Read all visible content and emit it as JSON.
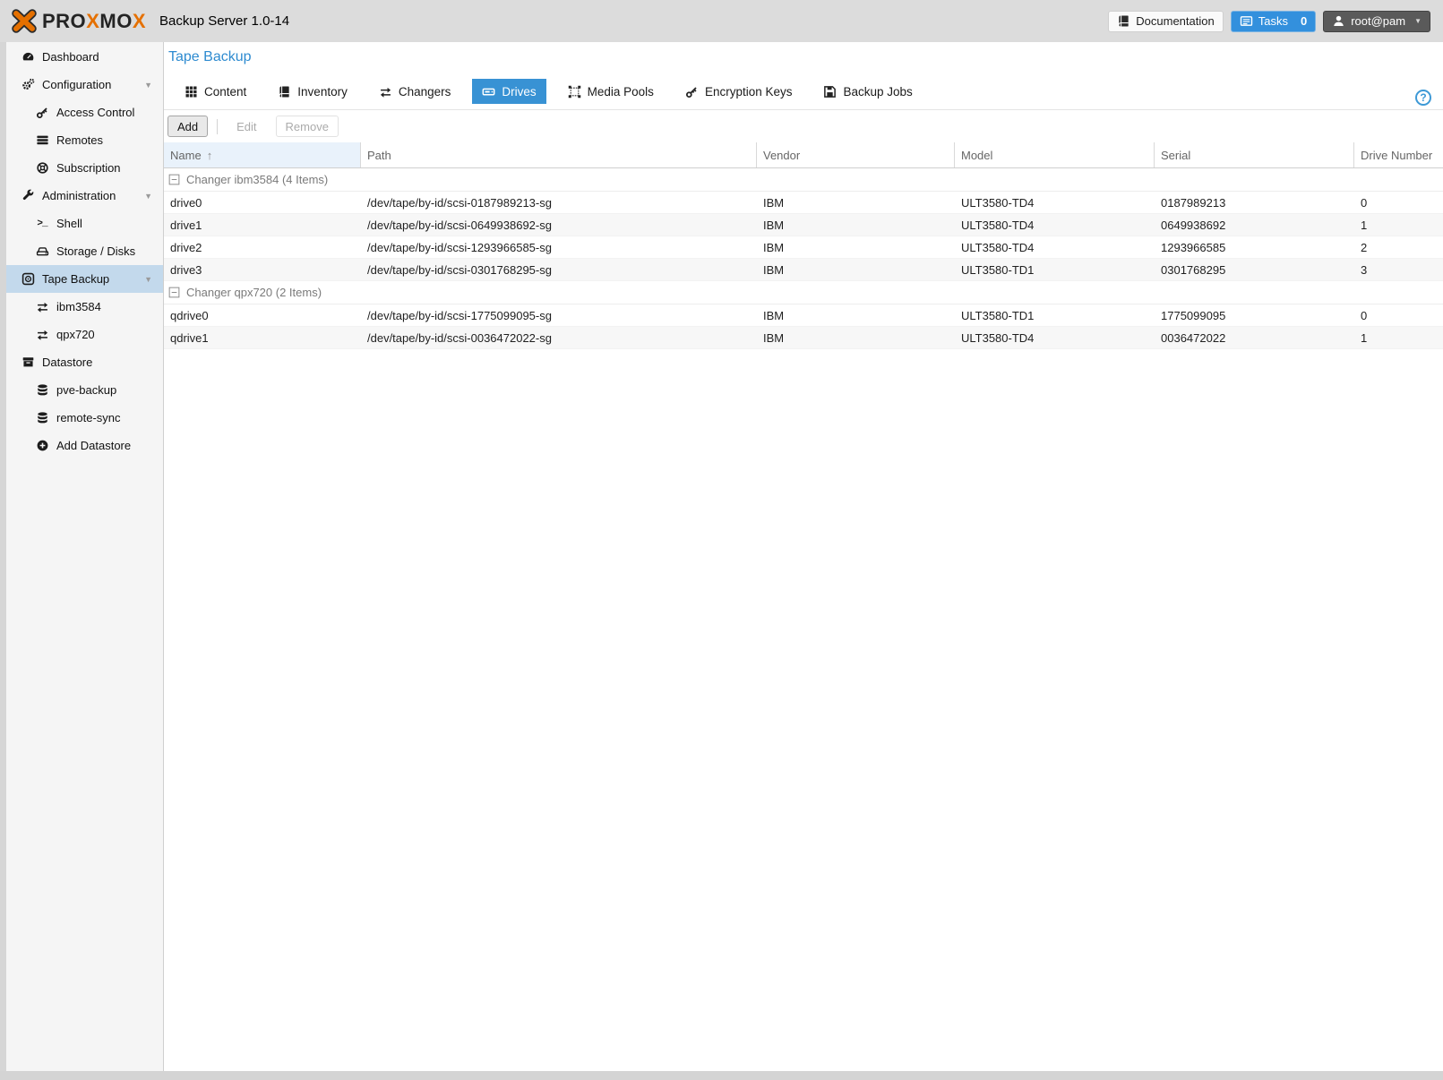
{
  "header": {
    "brand_pro": "PRO",
    "brand_x1": "X",
    "brand_mo": "MO",
    "brand_x2": "X",
    "app_title": "Backup Server 1.0-14",
    "documentation_label": "Documentation",
    "tasks_label": "Tasks",
    "tasks_count": "0",
    "user_label": "root@pam"
  },
  "sidebar": {
    "items": [
      {
        "label": "Dashboard",
        "icon": "dashboard-gauge",
        "level": 0
      },
      {
        "label": "Configuration",
        "icon": "gears",
        "level": 0,
        "expanded": true
      },
      {
        "label": "Access Control",
        "icon": "key",
        "level": 1
      },
      {
        "label": "Remotes",
        "icon": "list-bars",
        "level": 1
      },
      {
        "label": "Subscription",
        "icon": "life-ring",
        "level": 1
      },
      {
        "label": "Administration",
        "icon": "wrench",
        "level": 0,
        "expanded": true
      },
      {
        "label": "Shell",
        "icon": "terminal",
        "level": 1
      },
      {
        "label": "Storage / Disks",
        "icon": "hdd",
        "level": 1
      },
      {
        "label": "Tape Backup",
        "icon": "tape",
        "level": 0,
        "expanded": true,
        "selected": true
      },
      {
        "label": "ibm3584",
        "icon": "exchange",
        "level": 1
      },
      {
        "label": "qpx720",
        "icon": "exchange",
        "level": 1
      },
      {
        "label": "Datastore",
        "icon": "archive-box",
        "level": 0
      },
      {
        "label": "pve-backup",
        "icon": "database",
        "level": 1
      },
      {
        "label": "remote-sync",
        "icon": "database",
        "level": 1
      },
      {
        "label": "Add Datastore",
        "icon": "plus-circle",
        "level": 1
      }
    ]
  },
  "content": {
    "page_title": "Tape Backup",
    "tabs": [
      {
        "label": "Content",
        "icon": "grid"
      },
      {
        "label": "Inventory",
        "icon": "book"
      },
      {
        "label": "Changers",
        "icon": "exchange"
      },
      {
        "label": "Drives",
        "icon": "tape-drive",
        "active": true
      },
      {
        "label": "Media Pools",
        "icon": "object-group"
      },
      {
        "label": "Encryption Keys",
        "icon": "key"
      },
      {
        "label": "Backup Jobs",
        "icon": "floppy"
      }
    ],
    "toolbar": {
      "add_label": "Add",
      "edit_label": "Edit",
      "remove_label": "Remove"
    },
    "table": {
      "columns": [
        "Name",
        "Path",
        "Vendor",
        "Model",
        "Serial",
        "Drive Number"
      ],
      "sort_column": "Name",
      "sort_direction": "asc",
      "groups": [
        {
          "label": "Changer ibm3584 (4 Items)",
          "rows": [
            {
              "name": "drive0",
              "path": "/dev/tape/by-id/scsi-0187989213-sg",
              "vendor": "IBM",
              "model": "ULT3580-TD4",
              "serial": "0187989213",
              "drive_number": "0"
            },
            {
              "name": "drive1",
              "path": "/dev/tape/by-id/scsi-0649938692-sg",
              "vendor": "IBM",
              "model": "ULT3580-TD4",
              "serial": "0649938692",
              "drive_number": "1"
            },
            {
              "name": "drive2",
              "path": "/dev/tape/by-id/scsi-1293966585-sg",
              "vendor": "IBM",
              "model": "ULT3580-TD4",
              "serial": "1293966585",
              "drive_number": "2"
            },
            {
              "name": "drive3",
              "path": "/dev/tape/by-id/scsi-0301768295-sg",
              "vendor": "IBM",
              "model": "ULT3580-TD1",
              "serial": "0301768295",
              "drive_number": "3"
            }
          ]
        },
        {
          "label": "Changer qpx720 (2 Items)",
          "rows": [
            {
              "name": "qdrive0",
              "path": "/dev/tape/by-id/scsi-1775099095-sg",
              "vendor": "IBM",
              "model": "ULT3580-TD1",
              "serial": "1775099095",
              "drive_number": "0"
            },
            {
              "name": "qdrive1",
              "path": "/dev/tape/by-id/scsi-0036472022-sg",
              "vendor": "IBM",
              "model": "ULT3580-TD4",
              "serial": "0036472022",
              "drive_number": "1"
            }
          ]
        }
      ]
    }
  },
  "colors": {
    "accent_blue": "#3892d4",
    "brand_orange": "#e57000",
    "nav_selected_bg": "#c3d9ec",
    "sorted_column_bg": "#e9f2fb",
    "header_bg": "#dcdcdc"
  }
}
